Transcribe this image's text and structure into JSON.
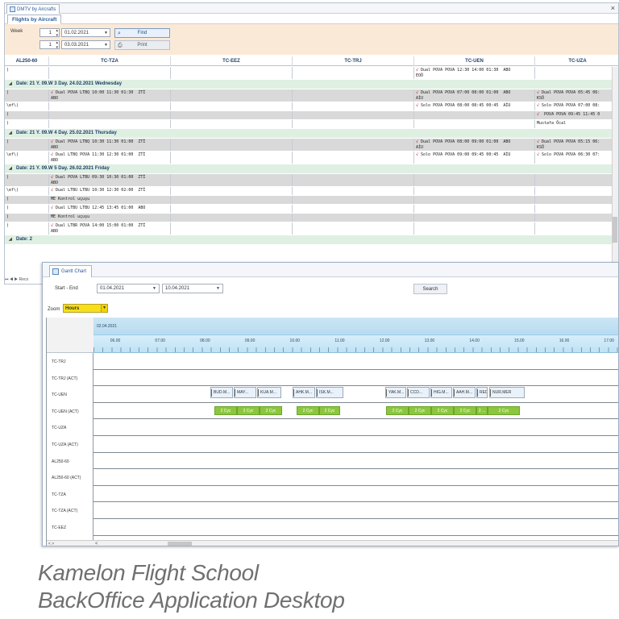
{
  "main_window": {
    "tab_label": "DMTV by Aircrafts",
    "close_label": "×",
    "subtab_label": "Flights by Aircraft",
    "week_label": "Week",
    "week_from": "1",
    "week_to": "1",
    "date_from": "01.02.2021",
    "date_to": "03.03.2021",
    "find_label": "Find",
    "print_label": "Print",
    "columns": [
      "AL250-60",
      "TC-TZA",
      "TC-EEZ",
      "TC-TRJ",
      "TC-UEN",
      "TC-UZA"
    ],
    "status_bar": "⏮ ◀ ▶ Reco"
  },
  "grid_rows": [
    {
      "kind": "row",
      "shade": "white",
      "c0": ")",
      "c1": "",
      "c4": "√ Dual POVA POVA 12:30 14:00 01:30  ABO\nEOÖ",
      "c5": ""
    },
    {
      "kind": "date",
      "label": "Date: 21 Y. 09.W 3 Day. 24.02.2021 Wednesday"
    },
    {
      "kind": "row",
      "shade": "grey",
      "c0": ")",
      "c1": "√ Dual POVA LTBQ 10:00 11:30 01:30  ZTİ\nABO",
      "c4": "√ Dual POVA POVA 07:00 08:00 01:00  ABO\nAİU",
      "c5": "√ Dual POVA POVA 05:45 06:\nKSÖ"
    },
    {
      "kind": "row",
      "shade": "white",
      "c0": "\\ef\\)",
      "c1": "",
      "c4": "√ Solo POVA POVA 08:00 08:45 00:45  AİU",
      "c5": "√ Solo POVA POVA 07:00 08:"
    },
    {
      "kind": "row",
      "shade": "grey",
      "c0": ")",
      "c1": "",
      "c4": "",
      "c5": "√  POVA POVA 09:45 11:45 0"
    },
    {
      "kind": "row",
      "shade": "white",
      "c0": ")",
      "c1": "",
      "c4": "",
      "c5": "Mustafa Öcal"
    },
    {
      "kind": "date",
      "label": "Date: 21 Y. 09.W 4 Day. 25.02.2021 Thursday"
    },
    {
      "kind": "row",
      "shade": "grey",
      "c0": ")",
      "c1": "√ Dual POVA LTBQ 10:30 11:30 01:00  ZTİ\nABO",
      "c4": "√ Dual POVA POVA 08:00 09:00 01:00  ABO\nAİU",
      "c5": "√ Dual POVA POVA 05:15 06:\nKSÖ"
    },
    {
      "kind": "row",
      "shade": "white",
      "c0": "\\ef\\)",
      "c1": "√ Dual LTBQ POVA 11:30 12:30 01:00  ZTİ\nABO",
      "c4": "√ Solo POVA POVA 09:00 09:45 00:45  AİU",
      "c5": "√ Solo POVA POVA 06:30 07:"
    },
    {
      "kind": "date",
      "label": "Date: 21 Y. 09.W 5 Day. 26.02.2021 Friday"
    },
    {
      "kind": "row",
      "shade": "grey",
      "c0": ")",
      "c1": "√ Dual POVA LTBU 09:30 10:30 01:00  ZTİ\nABO",
      "c4": "",
      "c5": ""
    },
    {
      "kind": "row",
      "shade": "white",
      "c0": "\\ef\\)",
      "c1": "√ Dual LTBU LTBU 10:30 12:30 02:00  ZTİ",
      "c4": "",
      "c5": ""
    },
    {
      "kind": "row",
      "shade": "grey",
      "c0": ")",
      "c1": "ME Kontrol uçuşu",
      "c4": "",
      "c5": ""
    },
    {
      "kind": "row",
      "shade": "white",
      "c0": ")",
      "c1": "√ Dual LTBU LTBU 12:45 13:45 01:00  ABO",
      "c4": "",
      "c5": ""
    },
    {
      "kind": "row",
      "shade": "grey",
      "c0": ")",
      "c1": "ME Kontrol uçuşu",
      "c4": "",
      "c5": ""
    },
    {
      "kind": "row",
      "shade": "white",
      "c0": ")",
      "c1": "√ Dual LTBR POVA 14:00 15:00 01:00  ZTİ\nABO",
      "c4": "",
      "c5": ""
    },
    {
      "kind": "date",
      "label": "Date: 2"
    }
  ],
  "gantt": {
    "tab_label": "Gantt Chart",
    "start_end_label": "Start - End",
    "start_date": "01.04.2021",
    "end_date": "10.04.2021",
    "search_label": "Search",
    "zoom_label": "Zoom",
    "zoom_value": "Hours",
    "date_band": "02.04.2021",
    "hours": [
      "06.00",
      "07.00",
      "08.00",
      "09.00",
      "10.00",
      "11.00",
      "12.00",
      "13.00",
      "14.00",
      "15.00",
      "16.00",
      "17.00"
    ],
    "rows": [
      "TC-TRJ",
      "TC-TRJ (ACT)",
      "TC-UEN",
      "TC-UEN (ACT)",
      "TC-UZA",
      "TC-UZA (ACT)",
      "AL250-60",
      "AL250-60 (ACT)",
      "TC-TZA",
      "TC-TZA (ACT)",
      "TC-EEZ"
    ],
    "flights": [
      "BUD.M...",
      "MAY...",
      "KUA.M...",
      "AHK.M...",
      "ISK.M...",
      "YAK.M...",
      "CCD...",
      "HIG.M...",
      "AAH.M...",
      "RED...",
      "NUR.MER"
    ],
    "actuals": [
      "2 Cyc",
      "2 Cyc",
      "2 Cyc",
      "2 Cyc",
      "2 Cyc",
      "2 Cyc",
      "2 Cyc",
      "2 Cyc",
      "2 Cyc",
      "2 ...",
      "2 Cyc"
    ],
    "left_scroll": "<    >",
    "right_scroll": "<"
  },
  "caption": {
    "line1": "Kamelon Flight School",
    "line2": "BackOffice Application Desktop"
  },
  "colors": {
    "filter_bg": "#fbe9d7",
    "date_row_bg": "#dff0e3",
    "cycle_green": "#8cc63f",
    "zoom_yellow": "#f7e019",
    "timeline_blue": "#bfe2f4"
  }
}
